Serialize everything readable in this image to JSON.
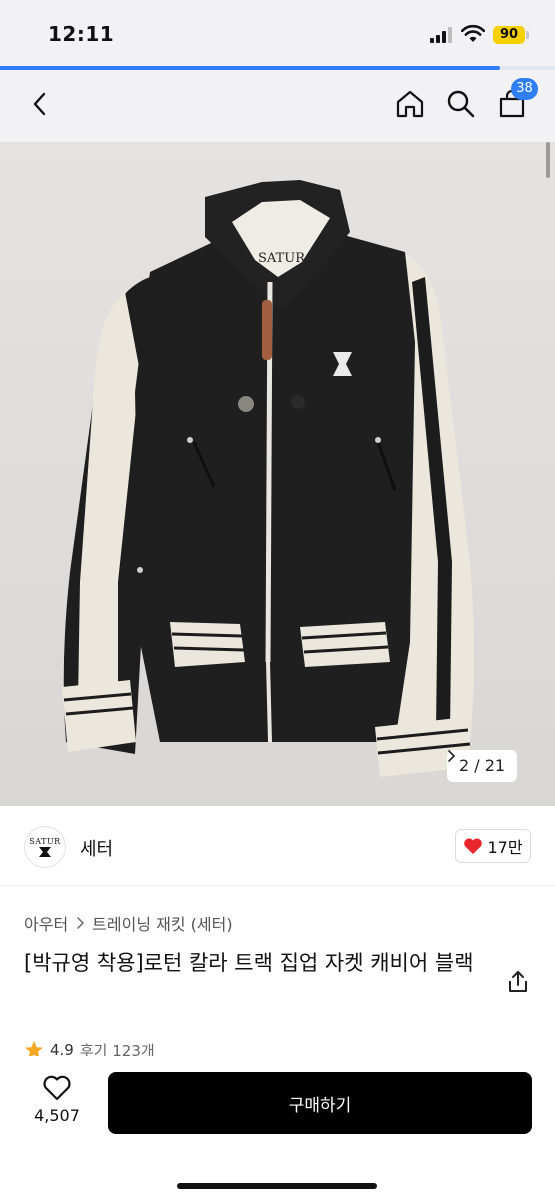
{
  "status_bar": {
    "time": "12:11",
    "battery": "90",
    "icons": [
      "signal-icon",
      "wifi-icon",
      "battery-icon"
    ],
    "page_load_progress": 0.9
  },
  "nav": {
    "icons": [
      "chevron-left-icon",
      "home-icon",
      "search-icon",
      "cart-icon"
    ],
    "cart_count": "38"
  },
  "gallery": {
    "current": "2",
    "total": "21",
    "counter": "2 / 21",
    "logo_text": "SATUR"
  },
  "brand": {
    "name": "세터",
    "logo_text": "SATUR",
    "like_count": "17만"
  },
  "product": {
    "breadcrumb": [
      "아우터",
      "트레이닝 재킷 (세터)"
    ],
    "title": "[박규영 착용]로턴 칼라 트랙 집업 자켓 캐비어 블랙",
    "rating": "4.9",
    "review": "후기 123개",
    "rating_icon": "star-icon"
  },
  "bottom_bar": {
    "wish_count": "4,507",
    "buy_label": "구매하기"
  },
  "colors": {
    "accent": "#2f7ef5",
    "battery": "#f7d000",
    "heart": "#e8262c",
    "star": "#f5a623",
    "buy_button": "#000000"
  }
}
